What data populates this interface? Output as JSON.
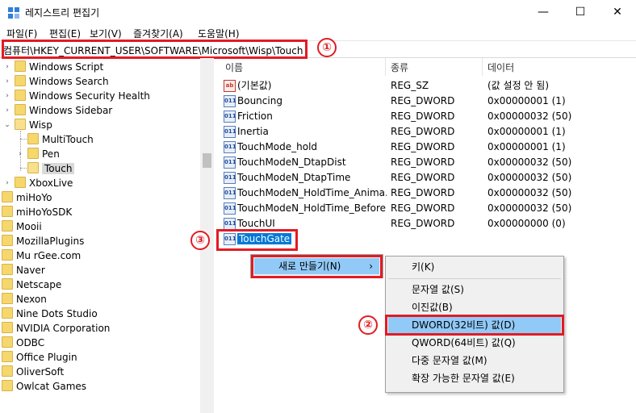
{
  "window": {
    "title": "레지스트리 편집기",
    "minimize": "—",
    "maximize": "☐",
    "close": "✕"
  },
  "menu": [
    "파일(F)",
    "편집(E)",
    "보기(V)",
    "즐겨찾기(A)",
    "도움말(H)"
  ],
  "address": "컴퓨터\\HKEY_CURRENT_USER\\SOFTWARE\\Microsoft\\Wisp\\Touch",
  "badges": [
    "①",
    "②",
    "③"
  ],
  "tree": [
    {
      "label": "Windows Script"
    },
    {
      "label": "Windows Search"
    },
    {
      "label": "Windows Security Health"
    },
    {
      "label": "Windows Sidebar"
    },
    {
      "label": "Wisp"
    },
    {
      "label": "MultiTouch"
    },
    {
      "label": "Pen"
    },
    {
      "label": "Touch"
    },
    {
      "label": "XboxLive"
    },
    {
      "label": "miHoYo"
    },
    {
      "label": "miHoYoSDK"
    },
    {
      "label": "Mooii"
    },
    {
      "label": "MozillaPlugins"
    },
    {
      "label": "Mu rGee.com"
    },
    {
      "label": "Naver"
    },
    {
      "label": "Netscape"
    },
    {
      "label": "Nexon"
    },
    {
      "label": "Nine Dots Studio"
    },
    {
      "label": "NVIDIA Corporation"
    },
    {
      "label": "ODBC"
    },
    {
      "label": "Office Plugin"
    },
    {
      "label": "OliverSoft"
    },
    {
      "label": "Owlcat Games"
    }
  ],
  "columns": {
    "name": "이름",
    "type": "종류",
    "data": "데이터"
  },
  "values": [
    {
      "name": "(기본값)",
      "type": "REG_SZ",
      "data": "(값 설정 안 됨)",
      "icon": "ab"
    },
    {
      "name": "Bouncing",
      "type": "REG_DWORD",
      "data": "0x00000001 (1)",
      "icon": "011"
    },
    {
      "name": "Friction",
      "type": "REG_DWORD",
      "data": "0x00000032 (50)",
      "icon": "011"
    },
    {
      "name": "Inertia",
      "type": "REG_DWORD",
      "data": "0x00000001 (1)",
      "icon": "011"
    },
    {
      "name": "TouchMode_hold",
      "type": "REG_DWORD",
      "data": "0x00000001 (1)",
      "icon": "011"
    },
    {
      "name": "TouchModeN_DtapDist",
      "type": "REG_DWORD",
      "data": "0x00000032 (50)",
      "icon": "011"
    },
    {
      "name": "TouchModeN_DtapTime",
      "type": "REG_DWORD",
      "data": "0x00000032 (50)",
      "icon": "011"
    },
    {
      "name": "TouchModeN_HoldTime_Anima...",
      "type": "REG_DWORD",
      "data": "0x00000032 (50)",
      "icon": "011"
    },
    {
      "name": "TouchModeN_HoldTime_Before...",
      "type": "REG_DWORD",
      "data": "0x00000032 (50)",
      "icon": "011"
    },
    {
      "name": "TouchUI",
      "type": "REG_DWORD",
      "data": "0x00000000 (0)",
      "icon": "011"
    },
    {
      "name": "TouchGate",
      "type": "",
      "data": "",
      "icon": "011"
    }
  ],
  "context_menu": {
    "new": "새로 만들기(N)",
    "arrow": "›",
    "items": [
      "키(K)",
      "문자열 값(S)",
      "이진값(B)",
      "DWORD(32비트) 값(D)",
      "QWORD(64비트) 값(Q)",
      "다중 문자열 값(M)",
      "확장 가능한 문자열 값(E)"
    ]
  }
}
